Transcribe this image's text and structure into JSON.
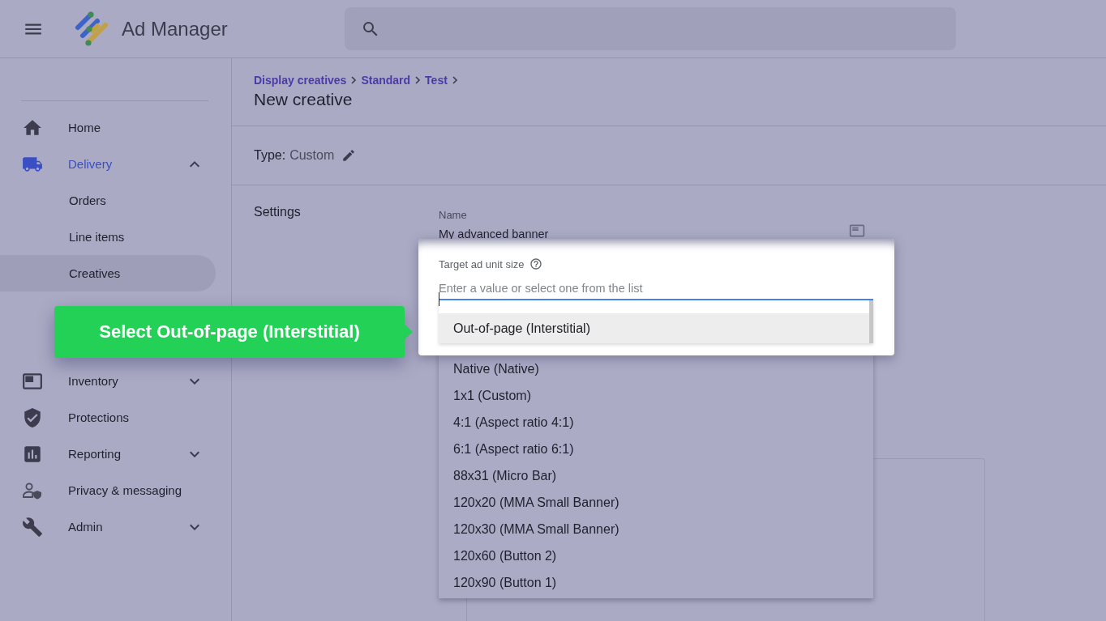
{
  "header": {
    "app_name": "Ad Manager"
  },
  "sidebar": {
    "items": [
      {
        "kind": "link",
        "label": "Home",
        "active": false
      },
      {
        "kind": "group",
        "label": "Delivery",
        "active": true,
        "expanded": true,
        "children": [
          {
            "label": "Orders",
            "selected": false
          },
          {
            "label": "Line items",
            "selected": false
          },
          {
            "label": "Creatives",
            "selected": true
          }
        ]
      },
      {
        "kind": "group",
        "label": "Inventory",
        "active": false,
        "expanded": false
      },
      {
        "kind": "link",
        "label": "Protections",
        "active": false
      },
      {
        "kind": "group",
        "label": "Reporting",
        "active": false,
        "expanded": false
      },
      {
        "kind": "link",
        "label": "Privacy & messaging",
        "active": false
      },
      {
        "kind": "group",
        "label": "Admin",
        "active": false,
        "expanded": false
      }
    ]
  },
  "breadcrumb": [
    "Display creatives",
    "Standard",
    "Test"
  ],
  "title": "New creative",
  "type": {
    "label": "Type:",
    "value": "Custom"
  },
  "settings": {
    "heading": "Settings",
    "name_field": {
      "label": "Name",
      "value": "My advanced banner"
    },
    "size_field": {
      "label": "Target ad unit size",
      "placeholder": "Enter a value or select one from the list",
      "focused": true
    }
  },
  "dropdown": {
    "options": [
      {
        "label": "Out-of-page (Interstitial)",
        "selected": true
      },
      {
        "label": "Native (Native)",
        "selected": false
      },
      {
        "label": "1x1 (Custom)",
        "selected": false
      },
      {
        "label": "4:1 (Aspect ratio 4:1)",
        "selected": false
      },
      {
        "label": "6:1 (Aspect ratio 6:1)",
        "selected": false
      },
      {
        "label": "88x31 (Micro Bar)",
        "selected": false
      },
      {
        "label": "120x20 (MMA Small Banner)",
        "selected": false
      },
      {
        "label": "120x30 (MMA Small Banner)",
        "selected": false
      },
      {
        "label": "120x60 (Button 2)",
        "selected": false
      },
      {
        "label": "120x90 (Button 1)",
        "selected": false
      }
    ]
  },
  "callout": {
    "text": "Select Out-of-page (Interstitial)"
  }
}
